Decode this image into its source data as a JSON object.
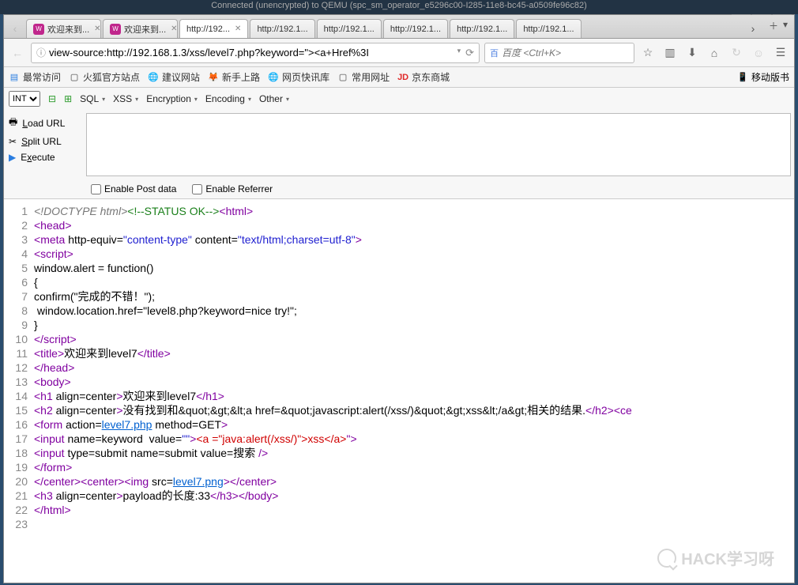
{
  "titlebar": "Connected (unencrypted) to QEMU (spc_sm_operator_e5296c00-I285-11e8-bc45-a0509fe96c82)",
  "tabs": [
    {
      "label": "欢迎来到...",
      "favicon": true
    },
    {
      "label": "欢迎来到...",
      "favicon": true
    },
    {
      "label": "http://192...",
      "active": true
    },
    {
      "label": "http://192.1..."
    },
    {
      "label": "http://192.1..."
    },
    {
      "label": "http://192.1..."
    },
    {
      "label": "http://192.1..."
    },
    {
      "label": "http://192.1..."
    }
  ],
  "url": "view-source:http://192.168.1.3/xss/level7.php?keyword=\"><a+Href%3I",
  "search": {
    "engine": "百",
    "placeholder": "百度 <Ctrl+K>"
  },
  "bookmarks": {
    "most": "最常访问",
    "items": [
      "火狐官方站点",
      "建议网站",
      "新手上路",
      "网页快讯库",
      "常用网址",
      "京东商城"
    ],
    "right": "移动版书"
  },
  "hackbar": {
    "select": "INT",
    "menus": [
      "SQL",
      "XSS",
      "Encryption",
      "Encoding",
      "Other"
    ],
    "actions": {
      "load": "Load URL",
      "split": "Split URL",
      "exec": "Execute"
    },
    "checks": {
      "post": "Enable Post data",
      "ref": "Enable Referrer"
    }
  },
  "source_lines": [
    {
      "n": 1,
      "parts": [
        {
          "c": "c-doctype",
          "t": "<!DOCTYPE html>"
        },
        {
          "c": "c-comment",
          "t": "<!--STATUS OK-->"
        },
        {
          "c": "c-tag",
          "t": "<html>"
        }
      ]
    },
    {
      "n": 2,
      "parts": [
        {
          "c": "c-tag",
          "t": "<head>"
        }
      ]
    },
    {
      "n": 3,
      "parts": [
        {
          "c": "c-tag",
          "t": "<"
        },
        {
          "c": "c-tag",
          "t": "meta "
        },
        {
          "c": "c-attr",
          "t": "http-equiv"
        },
        {
          "c": "c-txt",
          "t": "="
        },
        {
          "c": "c-val",
          "t": "\"content-type\""
        },
        {
          "c": "c-attr",
          "t": " content"
        },
        {
          "c": "c-txt",
          "t": "="
        },
        {
          "c": "c-val",
          "t": "\"text/html;charset=utf-8\""
        },
        {
          "c": "c-tag",
          "t": ">"
        }
      ]
    },
    {
      "n": 4,
      "parts": [
        {
          "c": "c-tag",
          "t": "<script>"
        }
      ]
    },
    {
      "n": 5,
      "parts": [
        {
          "c": "c-txt",
          "t": "window.alert = function()"
        }
      ]
    },
    {
      "n": 6,
      "parts": [
        {
          "c": "c-txt",
          "t": "{"
        }
      ]
    },
    {
      "n": 7,
      "parts": [
        {
          "c": "c-txt",
          "t": "confirm(\"完成的不错！\");"
        }
      ]
    },
    {
      "n": 8,
      "parts": [
        {
          "c": "c-txt",
          "t": " window.location.href=\"level8.php?keyword=nice try!\";"
        }
      ]
    },
    {
      "n": 9,
      "parts": [
        {
          "c": "c-txt",
          "t": "}"
        }
      ]
    },
    {
      "n": 10,
      "parts": [
        {
          "c": "c-tag",
          "t": "</script>"
        }
      ]
    },
    {
      "n": 11,
      "parts": [
        {
          "c": "c-tag",
          "t": "<title>"
        },
        {
          "c": "c-txt",
          "t": "欢迎来到level7"
        },
        {
          "c": "c-tag",
          "t": "</title>"
        }
      ]
    },
    {
      "n": 12,
      "parts": [
        {
          "c": "c-tag",
          "t": "</head>"
        }
      ]
    },
    {
      "n": 13,
      "parts": [
        {
          "c": "c-tag",
          "t": "<body>"
        }
      ]
    },
    {
      "n": 14,
      "parts": [
        {
          "c": "c-tag",
          "t": "<h1 "
        },
        {
          "c": "c-attr",
          "t": "align"
        },
        {
          "c": "c-txt",
          "t": "="
        },
        {
          "c": "c-attr",
          "t": "center"
        },
        {
          "c": "c-tag",
          "t": ">"
        },
        {
          "c": "c-txt",
          "t": "欢迎来到level7"
        },
        {
          "c": "c-tag",
          "t": "</h1>"
        }
      ]
    },
    {
      "n": 15,
      "parts": [
        {
          "c": "c-tag",
          "t": "<h2 "
        },
        {
          "c": "c-attr",
          "t": "align"
        },
        {
          "c": "c-txt",
          "t": "="
        },
        {
          "c": "c-attr",
          "t": "center"
        },
        {
          "c": "c-tag",
          "t": ">"
        },
        {
          "c": "c-txt",
          "t": "没有找到和&quot;&gt;&lt;a href=&quot;javascript:alert(/xss/)&quot;&gt;xss&lt;/a&gt;相关的结果."
        },
        {
          "c": "c-tag",
          "t": "</h2><ce"
        }
      ]
    },
    {
      "n": 16,
      "parts": [
        {
          "c": "c-tag",
          "t": "<form "
        },
        {
          "c": "c-attr",
          "t": "action"
        },
        {
          "c": "c-txt",
          "t": "="
        },
        {
          "c": "c-link",
          "t": "level7.php"
        },
        {
          "c": "c-attr",
          "t": " method"
        },
        {
          "c": "c-txt",
          "t": "="
        },
        {
          "c": "c-attr",
          "t": "GET"
        },
        {
          "c": "c-tag",
          "t": ">"
        }
      ]
    },
    {
      "n": 17,
      "parts": [
        {
          "c": "c-tag",
          "t": "<input "
        },
        {
          "c": "c-attr",
          "t": "name"
        },
        {
          "c": "c-txt",
          "t": "="
        },
        {
          "c": "c-attr",
          "t": "keyword  "
        },
        {
          "c": "c-attr",
          "t": "value"
        },
        {
          "c": "c-txt",
          "t": "="
        },
        {
          "c": "c-val",
          "t": "\"\""
        },
        {
          "c": "c-tag",
          "t": ">"
        },
        {
          "c": "c-txt",
          "t": "<a =\"java:alert(/xss/)\">xss</a>"
        },
        {
          "c": "c-tag",
          "t": "\">"
        }
      ]
    },
    {
      "n": 18,
      "parts": [
        {
          "c": "c-tag",
          "t": "<input "
        },
        {
          "c": "c-attr",
          "t": "type"
        },
        {
          "c": "c-txt",
          "t": "="
        },
        {
          "c": "c-attr",
          "t": "submit "
        },
        {
          "c": "c-attr",
          "t": "name"
        },
        {
          "c": "c-txt",
          "t": "="
        },
        {
          "c": "c-attr",
          "t": "submit "
        },
        {
          "c": "c-attr",
          "t": "value"
        },
        {
          "c": "c-txt",
          "t": "="
        },
        {
          "c": "c-attr",
          "t": "搜索"
        },
        {
          "c": "c-tag",
          "t": " />"
        }
      ]
    },
    {
      "n": 19,
      "parts": [
        {
          "c": "c-tag",
          "t": "</form>"
        }
      ]
    },
    {
      "n": 20,
      "parts": [
        {
          "c": "c-tag",
          "t": "</center><center><img "
        },
        {
          "c": "c-attr",
          "t": "src"
        },
        {
          "c": "c-txt",
          "t": "="
        },
        {
          "c": "c-link",
          "t": "level7.png"
        },
        {
          "c": "c-tag",
          "t": "></center>"
        }
      ]
    },
    {
      "n": 21,
      "parts": [
        {
          "c": "c-tag",
          "t": "<h3 "
        },
        {
          "c": "c-attr",
          "t": "align"
        },
        {
          "c": "c-txt",
          "t": "="
        },
        {
          "c": "c-attr",
          "t": "center"
        },
        {
          "c": "c-tag",
          "t": ">"
        },
        {
          "c": "c-txt",
          "t": "payload的长度:33"
        },
        {
          "c": "c-tag",
          "t": "</h3></body>"
        }
      ]
    },
    {
      "n": 22,
      "parts": [
        {
          "c": "c-tag",
          "t": "</html>"
        }
      ]
    },
    {
      "n": 23,
      "parts": [
        {
          "c": "c-txt",
          "t": ""
        }
      ]
    }
  ],
  "watermark": "HACK学习呀"
}
